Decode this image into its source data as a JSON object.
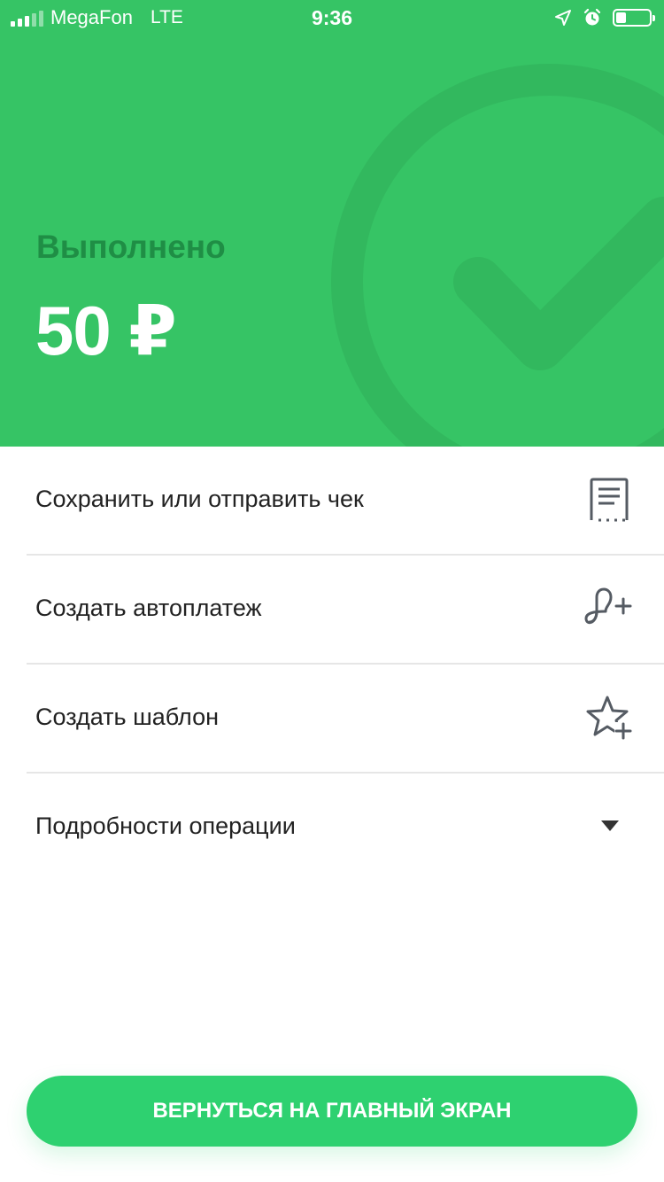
{
  "status_bar": {
    "carrier": "MegaFon",
    "network": "LTE",
    "time": "9:36",
    "battery_level": 0.3
  },
  "result": {
    "title": "Выполнено",
    "amount": "50 ₽"
  },
  "actions": [
    {
      "label": "Сохранить или отправить чек",
      "icon": "receipt-icon"
    },
    {
      "label": "Создать автоплатеж",
      "icon": "autopay-icon"
    },
    {
      "label": "Создать шаблон",
      "icon": "star-plus-icon"
    },
    {
      "label": "Подробности операции",
      "icon": "caret-down-icon"
    }
  ],
  "home_button": {
    "label": "ВЕРНУТЬСЯ НА ГЛАВНЫЙ ЭКРАН"
  },
  "colors": {
    "hero": "#36c465",
    "accent_text": "#1f8e45",
    "button": "#2ed170",
    "icon": "#555b63"
  }
}
